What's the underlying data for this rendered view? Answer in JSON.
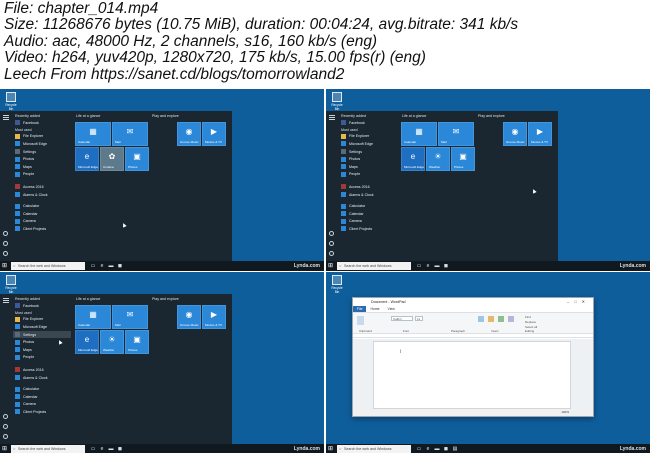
{
  "info": {
    "lines": [
      "File: chapter_014.mp4",
      "Size: 11268676 bytes (10.75 MiB), duration: 00:04:24, avg.bitrate: 341 kb/s",
      "Audio: aac, 48000 Hz, 2 channels, s16, 160 kb/s (eng)",
      "Video: h264, yuv420p, 1280x720, 175 kb/s, 15.00 fps(r) (eng)",
      "Leech From https://sanet.cd/blogs/tomorrowland2"
    ]
  },
  "desktop": {
    "recycle_bin": "Recycle Bin",
    "color": "#0f5e9c"
  },
  "start_menu": {
    "recently_added": "Recently added",
    "most_used": "Most used",
    "apps": [
      "Facebook",
      "File Explorer",
      "Microsoft Edge",
      "Settings",
      "Photos",
      "Maps",
      "People",
      "Access 2016",
      "Alarms & Clock",
      "Calculator",
      "Calendar",
      "Camera",
      "Client Projects"
    ],
    "life_group": "Life at a glance",
    "play_group": "Play and explore",
    "tiles": {
      "calendar": "Calendar",
      "mail": "Mail",
      "edge": "Microsoft Edge",
      "cortana": "Cortana",
      "weather": "Weather",
      "photos": "Photos",
      "groove": "Groove Music",
      "movies": "Movies & TV",
      "collections": "Experience"
    }
  },
  "taskbar": {
    "search_placeholder": "Search the web and Windows",
    "watermark": "Lynda.com"
  },
  "wordpad": {
    "title": "Document - WordPad",
    "tabs": [
      "File",
      "Home",
      "View"
    ],
    "ribbon": {
      "clipboard": "Clipboard",
      "font": "Font",
      "paragraph": "Paragraph",
      "insert": "Insert",
      "editing": "Editing",
      "font_name": "Calibri",
      "font_size": "11",
      "picture": "Picture",
      "paint_drawing": "Paint drawing",
      "date_time": "Date and time",
      "insert_object": "Insert object",
      "find": "Find",
      "replace": "Replace",
      "select_all": "Select all"
    },
    "zoom": "100%"
  },
  "colors": {
    "tile_blue": "#2b88d8",
    "menu_bg": "#1b2730",
    "taskbar_bg": "#101820",
    "wordpad_accent": "#2b6cb0"
  }
}
